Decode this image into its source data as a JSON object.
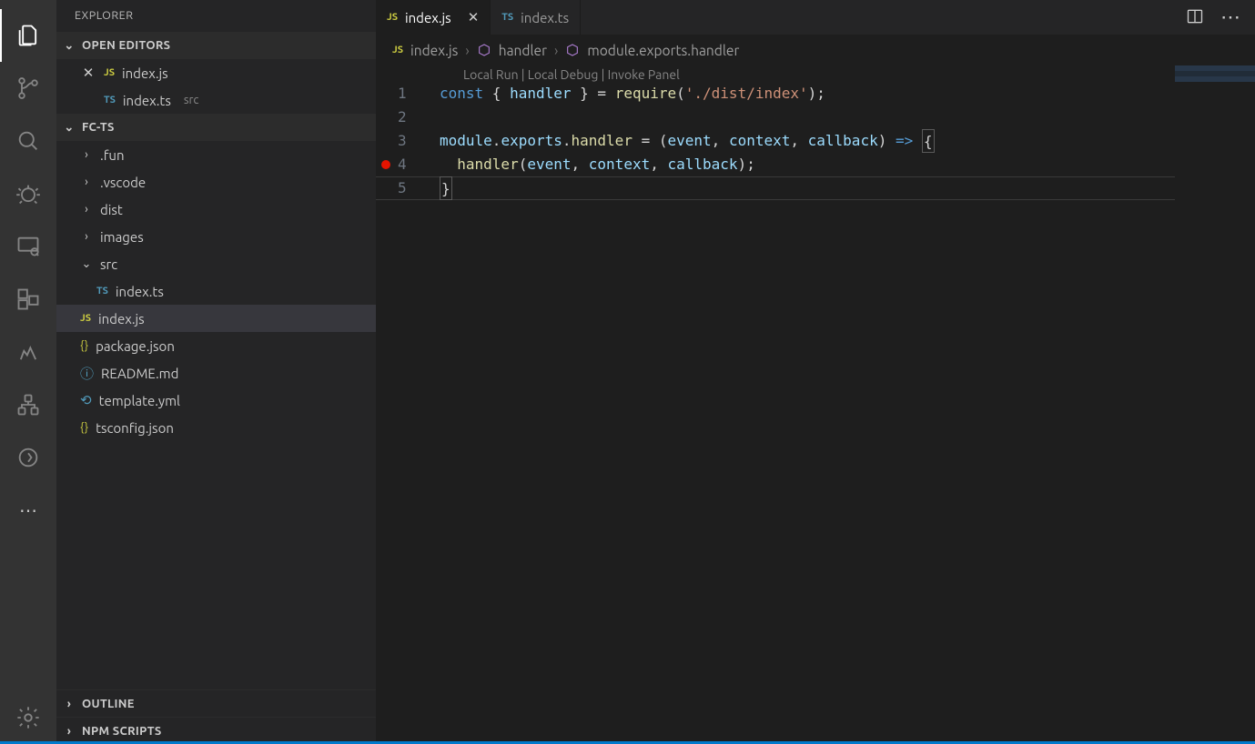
{
  "sidebar": {
    "title": "EXPLORER",
    "open_editors_header": "OPEN EDITORS",
    "open_editors": [
      {
        "name": "index.js",
        "lang": "JS",
        "close": "×"
      },
      {
        "name": "index.ts",
        "lang": "TS",
        "dir": "src"
      }
    ],
    "project_header": "FC-TS",
    "tree": {
      "fun": ".fun",
      "vscode": ".vscode",
      "dist": "dist",
      "images": "images",
      "src": "src",
      "src_indexts": "index.ts",
      "indexjs": "index.js",
      "package": "package.json",
      "readme": "README.md",
      "template": "template.yml",
      "tsconfig": "tsconfig.json"
    },
    "outline_header": "OUTLINE",
    "npm_header": "NPM SCRIPTS"
  },
  "tabs": {
    "t0": {
      "label": "index.js",
      "lang": "JS"
    },
    "t1": {
      "label": "index.ts",
      "lang": "TS"
    }
  },
  "breadcrumbs": {
    "b0": "index.js",
    "b1": "handler",
    "b2": "module.exports.handler"
  },
  "codelens": "Local Run | Local Debug | Invoke Panel",
  "code": {
    "ln1": "1",
    "ln2": "2",
    "ln3": "3",
    "ln4": "4",
    "ln5": "5",
    "l1": {
      "const": "const",
      "lb": " { ",
      "handler": "handler",
      "rb": " } ",
      "eq": "= ",
      "require": "require",
      "lp": "(",
      "str": "'./dist/index'",
      "rp": ")",
      "sc": ";"
    },
    "l3": {
      "module": "module",
      "d1": ".",
      "exports": "exports",
      "d2": ".",
      "handler": "handler",
      "eq": " = ",
      "lp": "(",
      "event": "event",
      "c1": ", ",
      "context": "context",
      "c2": ", ",
      "callback": "callback",
      "rp": ") ",
      "arrow": "=>",
      "sp": " ",
      "ob": "{"
    },
    "l4": {
      "pad": "  ",
      "handler": "handler",
      "lp": "(",
      "event": "event",
      "c1": ", ",
      "context": "context",
      "c2": ", ",
      "callback": "callback",
      "rp": ")",
      "sc": ";"
    },
    "l5": {
      "cb": "}"
    }
  }
}
